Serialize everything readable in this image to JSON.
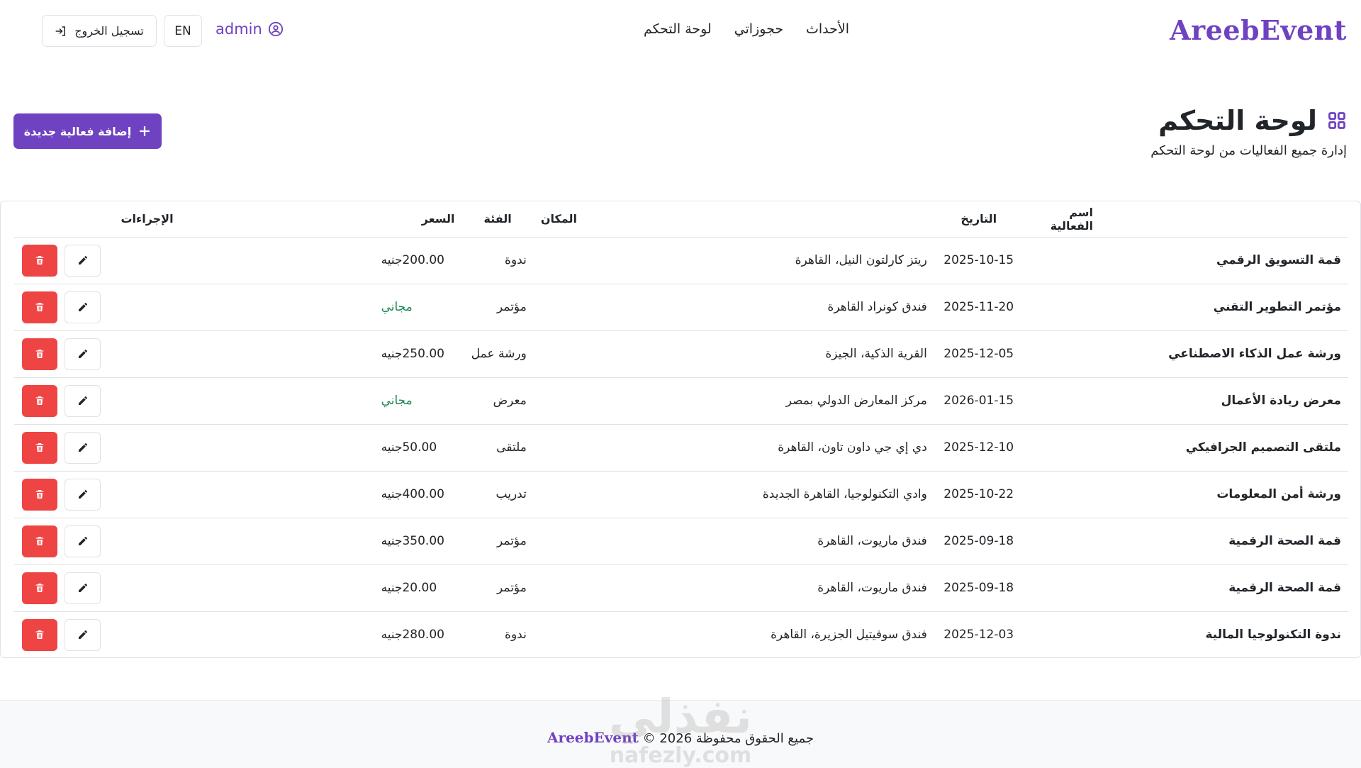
{
  "navbar": {
    "brand": "AreebEvent",
    "links": [
      "الأحداث",
      "حجوزاتي",
      "لوحة التحكم"
    ],
    "user": "admin",
    "lang": "EN",
    "logout": "تسجيل الخروج"
  },
  "header": {
    "title": "لوحة التحكم",
    "subtitle": "إدارة جميع الفعاليات من لوحة التحكم",
    "add_button": "إضافة فعالية جديدة"
  },
  "table": {
    "columns": {
      "name": "اسم الفعالية",
      "date": "التاريخ",
      "venue": "المكان",
      "category": "الفئة",
      "price": "السعر",
      "actions": "الإجراءات"
    },
    "rows": [
      {
        "name": "قمة التسويق الرقمي",
        "date": "2025-10-15",
        "venue": "ريتز كارلتون النيل، القاهرة",
        "category": "ندوة",
        "price": "200.00جنيه"
      },
      {
        "name": "مؤتمر التطوير التقني",
        "date": "2025-11-20",
        "venue": "فندق كونراد القاهرة",
        "category": "مؤتمر",
        "price": "مجاني"
      },
      {
        "name": "ورشة عمل الذكاء الاصطناعي",
        "date": "2025-12-05",
        "venue": "القرية الذكية، الجيزة",
        "category": "ورشة عمل",
        "price": "250.00جنيه"
      },
      {
        "name": "معرض ريادة الأعمال",
        "date": "2026-01-15",
        "venue": "مركز المعارض الدولي بمصر",
        "category": "معرض",
        "price": "مجاني"
      },
      {
        "name": "ملتقى التصميم الجرافيكي",
        "date": "2025-12-10",
        "venue": "دي إي جي داون تاون، القاهرة",
        "category": "ملتقى",
        "price": "50.00جنيه"
      },
      {
        "name": "ورشة أمن المعلومات",
        "date": "2025-10-22",
        "venue": "وادي التكنولوجيا، القاهرة الجديدة",
        "category": "تدريب",
        "price": "400.00جنيه"
      },
      {
        "name": "قمة الصحة الرقمية",
        "date": "2025-09-18",
        "venue": "فندق ماريوت، القاهرة",
        "category": "مؤتمر",
        "price": "350.00جنيه"
      },
      {
        "name": "قمة الصحة الرقمية",
        "date": "2025-09-18",
        "venue": "فندق ماريوت، القاهرة",
        "category": "مؤتمر",
        "price": "20.00جنيه"
      },
      {
        "name": "ندوة التكنولوجيا المالية",
        "date": "2025-12-03",
        "venue": "فندق سوفيتيل الجزيرة، القاهرة",
        "category": "ندوة",
        "price": "280.00جنيه"
      }
    ]
  },
  "footer": {
    "prefix": "جميع الحقوق محفوظة",
    "brand": "AreebEvent",
    "suffix": "© 2026"
  },
  "watermark": {
    "arabic": "نفذلي",
    "latin": "nafezly.com"
  },
  "colors": {
    "brand": "#6f42c1",
    "danger": "#ef4444",
    "free": "#198754",
    "border": "#dee2e6"
  },
  "icons": {
    "user": "user-circle-icon",
    "logout": "logout-icon",
    "grid": "grid-icon",
    "add": "plus-icon",
    "edit": "pencil-icon",
    "delete": "trash-icon"
  }
}
